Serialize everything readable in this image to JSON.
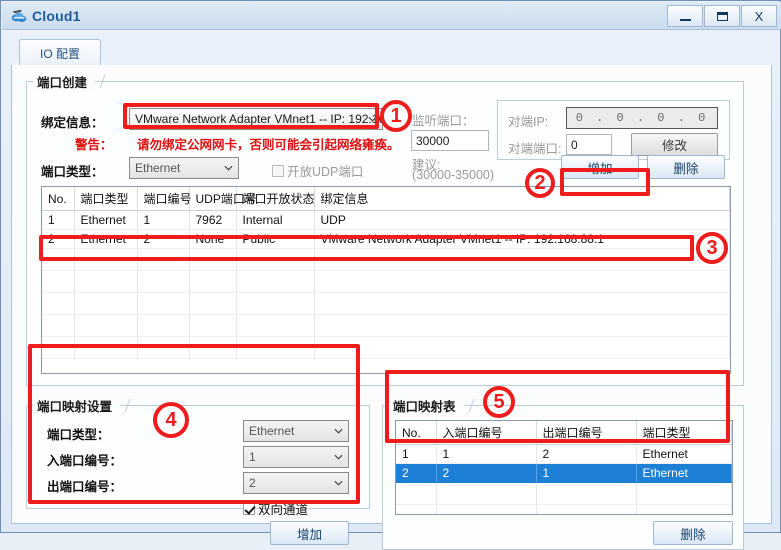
{
  "window": {
    "title": "Cloud1",
    "icon": "cloud-icon",
    "buttons": {
      "minimize": "minimize-icon",
      "maximize": "maximize-icon",
      "close": "X"
    }
  },
  "tabs": [
    {
      "label": "IO 配置",
      "active": true
    }
  ],
  "port_create": {
    "title": "端口创建",
    "binding_label": "绑定信息：",
    "binding_value": "VMware Network Adapter VMnet1 -- IP: 192.16",
    "warning_label": "警告：",
    "warning_text": "请勿绑定公网网卡，否则可能会引起网络雍痪。",
    "port_type_label": "端口类型：",
    "port_type_value": "Ethernet",
    "udp_checkbox_label": "开放UDP端口",
    "udp_checked": false,
    "listen_port_label": "监听端口：",
    "listen_port_value": "30000",
    "suggest_label": "建议:",
    "suggest_range": "(30000-35000)",
    "peer_ip_label": "对端IP:",
    "peer_ip_value": "0  .  0  .  0  .  0",
    "peer_port_label": "对端端口:",
    "peer_port_value": "0",
    "modify_button": "修改",
    "add_button": "增加",
    "delete_button": "删除"
  },
  "port_table": {
    "columns": [
      "No.",
      "端口类型",
      "端口编号",
      "UDP端口号",
      "端口开放状态",
      "绑定信息"
    ],
    "rows": [
      {
        "no": "1",
        "type": "Ethernet",
        "num": "1",
        "udp": "7962",
        "state": "Internal",
        "binding": "UDP",
        "selected": false
      },
      {
        "no": "2",
        "type": "Ethernet",
        "num": "2",
        "udp": "None",
        "state": "Public",
        "binding": "VMware Network Adapter VMnet1 -- IP: 192.168.88.1",
        "selected": false
      }
    ],
    "empty_rows": 5
  },
  "mapping_settings": {
    "title": "端口映射设置",
    "port_type_label": "端口类型：",
    "port_type_value": "Ethernet",
    "in_port_label": "入端口编号：",
    "in_port_value": "1",
    "out_port_label": "出端口编号：",
    "out_port_value": "2",
    "bidirectional_label": "双向通道",
    "bidirectional_checked": true,
    "add_button": "增加"
  },
  "mapping_table": {
    "title": "端口映射表",
    "columns": [
      "No.",
      "入端口编号",
      "出端口编号",
      "端口类型"
    ],
    "rows": [
      {
        "no": "1",
        "in": "1",
        "out": "2",
        "type": "Ethernet",
        "selected": false
      },
      {
        "no": "2",
        "in": "2",
        "out": "1",
        "type": "Ethernet",
        "selected": true
      }
    ],
    "empty_rows": 3,
    "delete_button": "删除"
  },
  "annotations": {
    "c1": "1",
    "c2": "2",
    "c3": "3",
    "c4": "4",
    "c5": "5"
  },
  "colors": {
    "annotation_red": "#ee1c1c",
    "selection_blue": "#1d7fd6",
    "title_blue": "#1f5c99",
    "warning_red": "#e01010"
  }
}
